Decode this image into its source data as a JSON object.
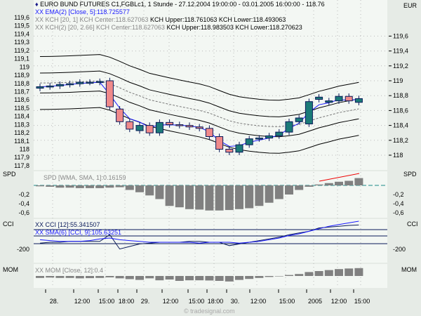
{
  "header": {
    "title": "EURO BUND FUTURES C1,FGBLc1, 1 Stunde - 27.12.2004 19:00:00 - 03.01.2005 16:00:00 - 118.76",
    "currency": "EUR"
  },
  "legends": {
    "ema": "XX EMA(2) [Close, 5]:118.725577",
    "kch1_center": "XX KCH [20, 1] KCH Center:118.627063",
    "kch1_rest": "KCH Upper:118.761063 KCH Lower:118.493063",
    "kch2_center": "XX KCH(2) [20, 2.66] KCH Center:118.627063",
    "kch2_rest": "KCH Upper:118.983503 KCH Lower:118.270623",
    "spd": "SPD [WMA, SMA, 1]:0.16159",
    "cci": "XX CCI [12]:55.341507",
    "cci_sma": "XX SMA(6) [CCI, 9]:105.63251",
    "mom": "XX MOM [Close, 12]:0.4"
  },
  "panel_labels": {
    "spd": "SPD",
    "cci": "CCI",
    "mom": "MOM"
  },
  "watermark": "© tradesignal.com",
  "colors": {
    "up": "#1b7b78",
    "down": "#f08a8a",
    "outline": "#0a1a5a",
    "ema": "#1a1aff",
    "bg": "#f3f7f3"
  },
  "chart_data": {
    "type": "candlestick",
    "left_ticks": [
      "119,6",
      "119,5",
      "119,4",
      "119,3",
      "119,2",
      "119,1",
      "119",
      "118,9",
      "118,8",
      "118,7",
      "118,6",
      "118,5",
      "118,4",
      "118,3",
      "118,2",
      "118,1",
      "118",
      "117,9",
      "117,8"
    ],
    "right_ticks": [
      "119,6",
      "119,4",
      "119,2",
      "119",
      "118,8",
      "118,6",
      "118,4",
      "118,2",
      "118"
    ],
    "x_ticks": [
      "28.",
      "12:00",
      "15:00",
      "18:00",
      "29.",
      "12:00",
      "15:00",
      "18:00",
      "30.",
      "12:00",
      "15:00",
      "2005",
      "12:00",
      "15:00"
    ],
    "spd_ticks": [
      "-0,2",
      "-0,4",
      "-0,6"
    ],
    "cci_ticks": [
      "-200"
    ],
    "open": [
      118.9,
      118.92,
      118.93,
      118.95,
      118.96,
      118.98,
      118.98,
      119.0,
      118.62,
      118.45,
      118.33,
      118.4,
      118.3,
      118.44,
      118.41,
      118.4,
      118.38,
      118.36,
      118.25,
      118.08,
      118.04,
      118.14,
      118.22,
      118.23,
      118.26,
      118.31,
      118.45,
      118.42,
      118.75,
      118.71,
      118.73,
      118.79,
      118.71
    ],
    "close": [
      118.92,
      118.93,
      118.95,
      118.96,
      118.98,
      118.98,
      118.99,
      118.65,
      118.45,
      118.35,
      118.4,
      118.3,
      118.44,
      118.41,
      118.4,
      118.38,
      118.36,
      118.25,
      118.08,
      118.04,
      118.14,
      118.22,
      118.23,
      118.26,
      118.31,
      118.45,
      118.5,
      118.72,
      118.78,
      118.73,
      118.79,
      118.73,
      118.76
    ],
    "spd": [
      -0.02,
      -0.03,
      -0.05,
      -0.05,
      -0.06,
      -0.06,
      -0.06,
      -0.05,
      -0.04,
      -0.1,
      -0.15,
      -0.22,
      -0.3,
      -0.45,
      -0.48,
      -0.52,
      -0.53,
      -0.55,
      -0.55,
      -0.54,
      -0.52,
      -0.5,
      -0.45,
      -0.38,
      -0.3,
      -0.2,
      -0.1,
      -0.03,
      0.02,
      0.05,
      0.08,
      0.1,
      0.16
    ],
    "cci": [
      -160,
      -150,
      -150,
      -140,
      -140,
      -140,
      -140,
      -60,
      -230,
      -200,
      -170,
      -160,
      -150,
      -150,
      -150,
      -140,
      -140,
      -150,
      -150,
      -190,
      -170,
      -150,
      -130,
      -110,
      -90,
      -60,
      -40,
      -20,
      20,
      30,
      40,
      50,
      55
    ],
    "cci_sma": [
      -120,
      -130,
      -140,
      -140,
      -140,
      -130,
      -110,
      -100,
      -120,
      -130,
      -140,
      -150,
      -150,
      -150,
      -150,
      -150,
      -160,
      -150,
      -150,
      -150,
      -160,
      -150,
      -140,
      -120,
      -100,
      -70,
      -50,
      -20,
      10,
      40,
      60,
      80,
      100
    ],
    "mom": [
      -0.1,
      -0.08,
      -0.1,
      -0.1,
      -0.12,
      -0.11,
      -0.1,
      -0.07,
      -0.12,
      -0.16,
      -0.2,
      -0.12,
      -0.22,
      -0.18,
      -0.25,
      -0.22,
      -0.22,
      -0.23,
      -0.25,
      -0.28,
      -0.2,
      -0.15,
      -0.1,
      -0.05,
      -0.02,
      0.05,
      0.1,
      0.2,
      0.25,
      0.3,
      0.35,
      0.38,
      0.4
    ]
  }
}
